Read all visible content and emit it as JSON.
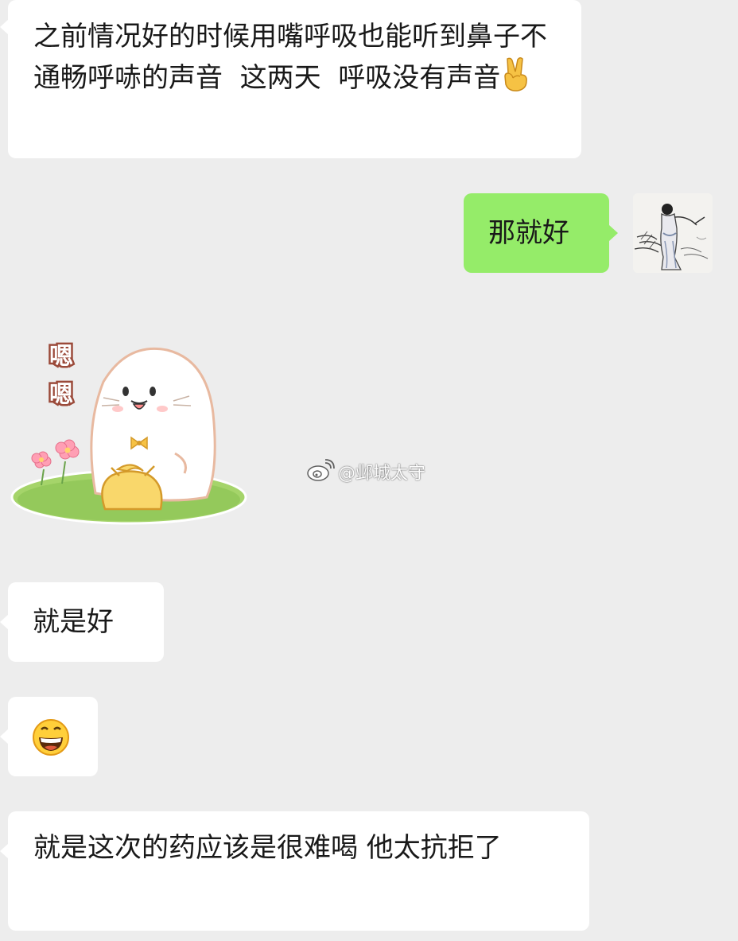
{
  "messages": [
    {
      "side": "left",
      "text": "之前情况好的时候用嘴呼吸也能听到鼻子不通畅呼哧的声音  这两天  呼吸没有声音",
      "emoji": "victory-hand"
    },
    {
      "side": "right",
      "text": "那就好"
    },
    {
      "side": "left",
      "type": "sticker",
      "sticker_text": "嗯嗯"
    },
    {
      "side": "left",
      "text": "就是好"
    },
    {
      "side": "left",
      "type": "emoji",
      "emoji": "grinning-face"
    },
    {
      "side": "left",
      "text": "就是这次的药应该是很难喝 他太抗拒了"
    }
  ],
  "watermark": {
    "text": "@邺城太守",
    "icon": "weibo-logo"
  },
  "colors": {
    "background": "#ededed",
    "incoming_bubble": "#ffffff",
    "outgoing_bubble": "#95ec69",
    "text": "#191919"
  }
}
